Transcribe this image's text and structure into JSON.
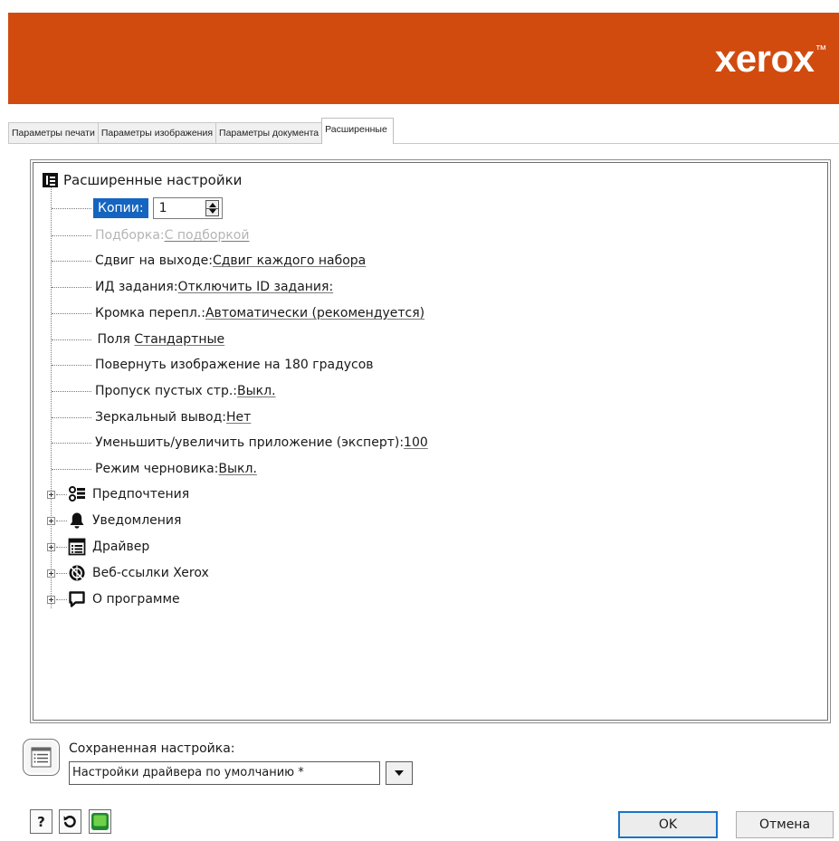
{
  "header": {
    "brand": "xerox",
    "tm": "™",
    "brand_color": "#d14b0f"
  },
  "tabs": [
    {
      "label": "Параметры печати",
      "active": false
    },
    {
      "label": "Параметры изображения",
      "active": false
    },
    {
      "label": "Параметры документа",
      "active": false
    },
    {
      "label": "Расширенные",
      "active": true
    }
  ],
  "tree": {
    "root_label": "Расширенные настройки",
    "copies": {
      "label": "Копии:",
      "value": "1"
    },
    "settings": [
      {
        "label": "Подборка: ",
        "value": "С подборкой",
        "disabled": true
      },
      {
        "label": "Сдвиг на выходе: ",
        "value": "Сдвиг каждого набора"
      },
      {
        "label": "ИД задания: ",
        "value": "Отключить ID задания:"
      },
      {
        "label": "Кромка перепл.: ",
        "value": "Автоматически (рекомендуется)"
      },
      {
        "label": " Поля ",
        "value": "Стандартные"
      },
      {
        "label": "Повернуть изображение на 180 градусов",
        "value": ""
      },
      {
        "label": "Пропуск пустых стр.: ",
        "value": "Выкл."
      },
      {
        "label": "Зеркальный вывод: ",
        "value": "Нет"
      },
      {
        "label": "Уменьшить/увеличить приложение (эксперт): ",
        "value": "100"
      },
      {
        "label": "Режим черновика: ",
        "value": "Выкл."
      }
    ],
    "groups": [
      {
        "label": "Предпочтения",
        "icon": "preferences-icon"
      },
      {
        "label": "Уведомления",
        "icon": "bell-icon"
      },
      {
        "label": "Драйвер",
        "icon": "driver-icon"
      },
      {
        "label": "Веб-ссылки Xerox",
        "icon": "web-links-icon"
      },
      {
        "label": "О программе",
        "icon": "speech-bubble-icon"
      }
    ]
  },
  "saved_settings": {
    "label": "Сохраненная настройка:",
    "value": "Настройки драйвера по умолчанию *"
  },
  "footer": {
    "help_label": "?",
    "ok_label": "OK",
    "cancel_label": "Отмена"
  }
}
